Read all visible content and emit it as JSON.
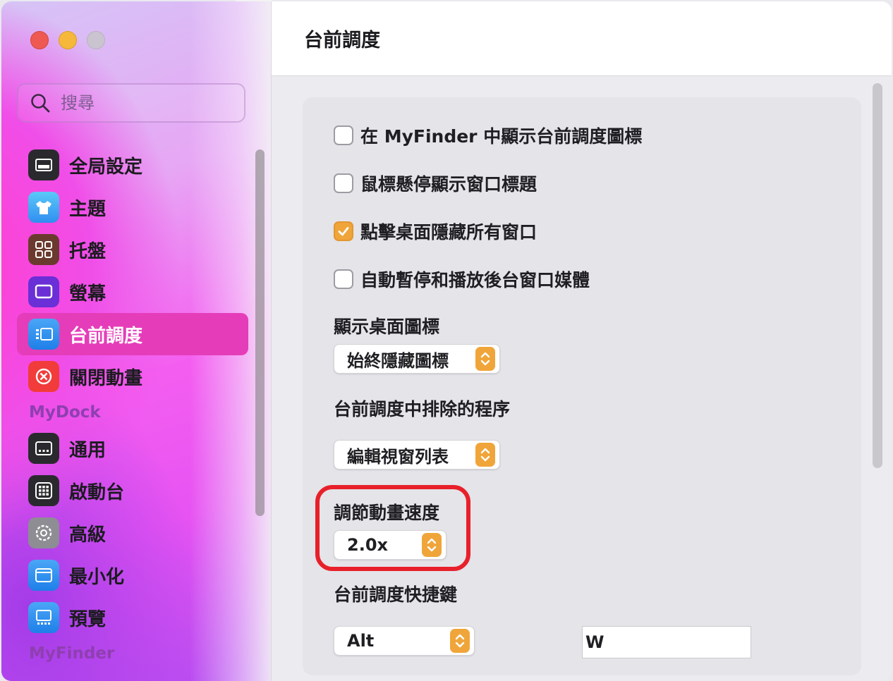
{
  "search": {
    "placeholder": "搜尋"
  },
  "sidebar": {
    "groups": [
      {
        "items": [
          {
            "label": "全局設定",
            "icon": "window-icon"
          },
          {
            "label": "主題",
            "icon": "tshirt-icon"
          },
          {
            "label": "托盤",
            "icon": "grid-icon"
          },
          {
            "label": "螢幕",
            "icon": "display-icon"
          },
          {
            "label": "台前調度",
            "icon": "stage-manager-icon",
            "active": true
          },
          {
            "label": "關閉動畫",
            "icon": "close-circle-icon"
          }
        ]
      },
      {
        "title": "MyDock",
        "items": [
          {
            "label": "通用",
            "icon": "dock-icon"
          },
          {
            "label": "啟動台",
            "icon": "launchpad-icon"
          },
          {
            "label": "高級",
            "icon": "gear-icon"
          },
          {
            "label": "最小化",
            "icon": "minimize-window-icon"
          },
          {
            "label": "預覽",
            "icon": "preview-icon"
          }
        ]
      },
      {
        "title": "MyFinder"
      }
    ]
  },
  "main": {
    "title": "台前調度",
    "checkboxes": [
      {
        "label": "在 MyFinder 中顯示台前調度圖標",
        "checked": false
      },
      {
        "label": "鼠標懸停顯示窗口標題",
        "checked": false
      },
      {
        "label": "點擊桌面隱藏所有窗口",
        "checked": true
      },
      {
        "label": "自動暫停和播放後台窗口媒體",
        "checked": false
      }
    ],
    "desktop_icons": {
      "label": "顯示桌面圖標",
      "value": "始終隱藏圖標"
    },
    "excluded_apps": {
      "label": "台前調度中排除的程序",
      "value": "編輯視窗列表"
    },
    "animation_speed": {
      "label": "調節動畫速度",
      "value": "2.0x"
    },
    "shortcut": {
      "label": "台前調度快捷鍵",
      "modifier": "Alt",
      "key": "W"
    }
  },
  "colors": {
    "accent": "#f0a53a",
    "active_item": "#e53db9",
    "highlight_ring": "#e8202a"
  }
}
